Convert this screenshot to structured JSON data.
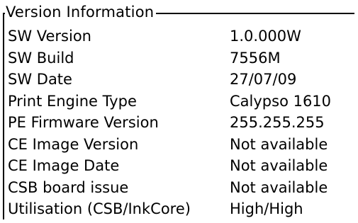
{
  "group": {
    "title": "Version Information"
  },
  "rows": [
    {
      "label": "SW Version",
      "value": "1.0.000W"
    },
    {
      "label": "SW Build",
      "value": "7556M"
    },
    {
      "label": "SW Date",
      "value": "27/07/09"
    },
    {
      "label": "Print Engine Type",
      "value": "Calypso 1610"
    },
    {
      "label": "PE Firmware Version",
      "value": "255.255.255"
    },
    {
      "label": "CE Image Version",
      "value": "Not available"
    },
    {
      "label": "CE Image Date",
      "value": "Not available"
    },
    {
      "label": "CSB board issue",
      "value": "Not available"
    },
    {
      "label": "Utilisation (CSB/InkCore)",
      "value": "High/High"
    }
  ]
}
